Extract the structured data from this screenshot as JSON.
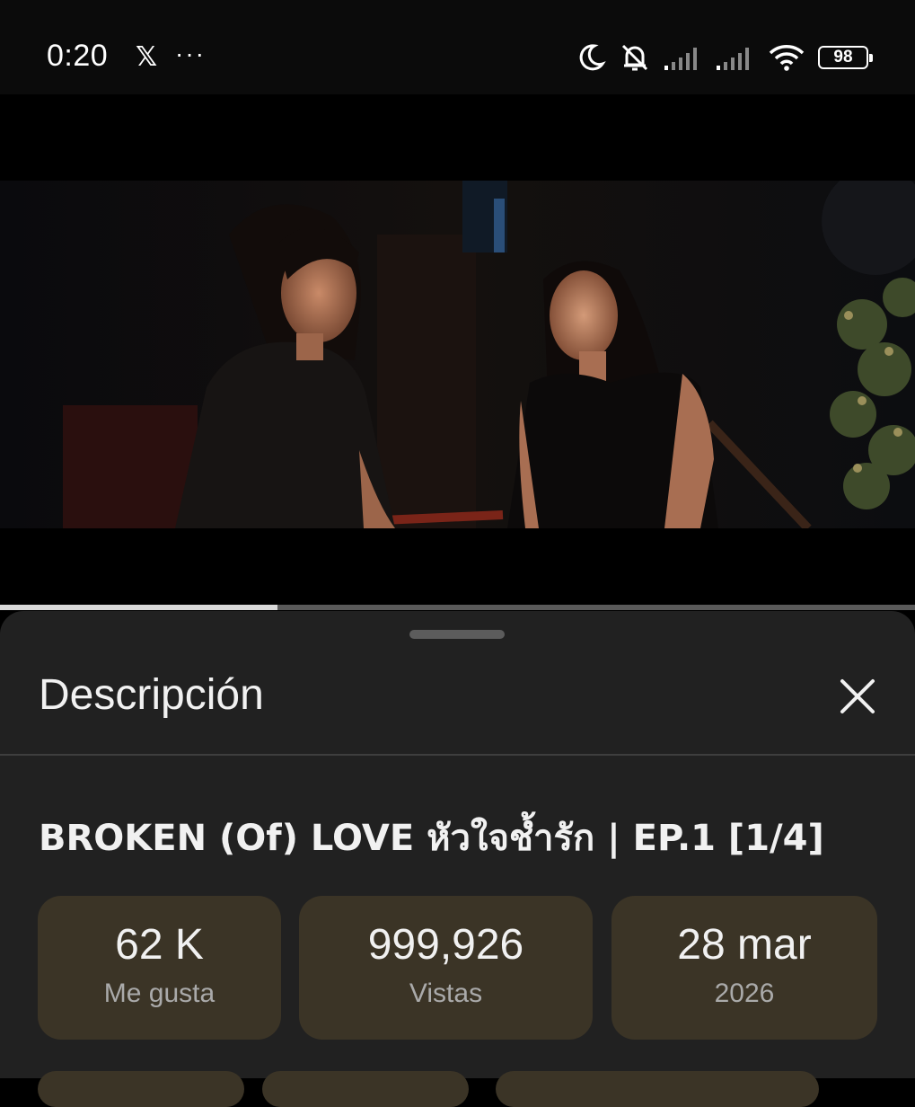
{
  "status_bar": {
    "time": "0:20",
    "app_icon": "x-logo-icon",
    "app_glyph": "𝕏",
    "more": "···",
    "battery": "98",
    "icons": [
      "moon-icon",
      "bell-off-icon",
      "signal-icon",
      "signal-icon",
      "wifi-icon",
      "battery-icon"
    ]
  },
  "video": {
    "progress": 0.303
  },
  "description_sheet": {
    "title": "Descripción",
    "close_icon": "close-icon",
    "video_title": "BROKEN (Of) LOVE หัวใจช้ำรัก | EP.1 [1/4]",
    "stats": [
      {
        "value": "62 K",
        "label": "Me gusta"
      },
      {
        "value": "999,926",
        "label": "Vistas"
      },
      {
        "value": "28 mar",
        "label": "2026"
      }
    ]
  },
  "colors": {
    "sheet_bg": "#212121",
    "card_bg": "#3b3426",
    "text_primary": "#f1f1f1",
    "text_secondary": "#aaaaaa"
  }
}
